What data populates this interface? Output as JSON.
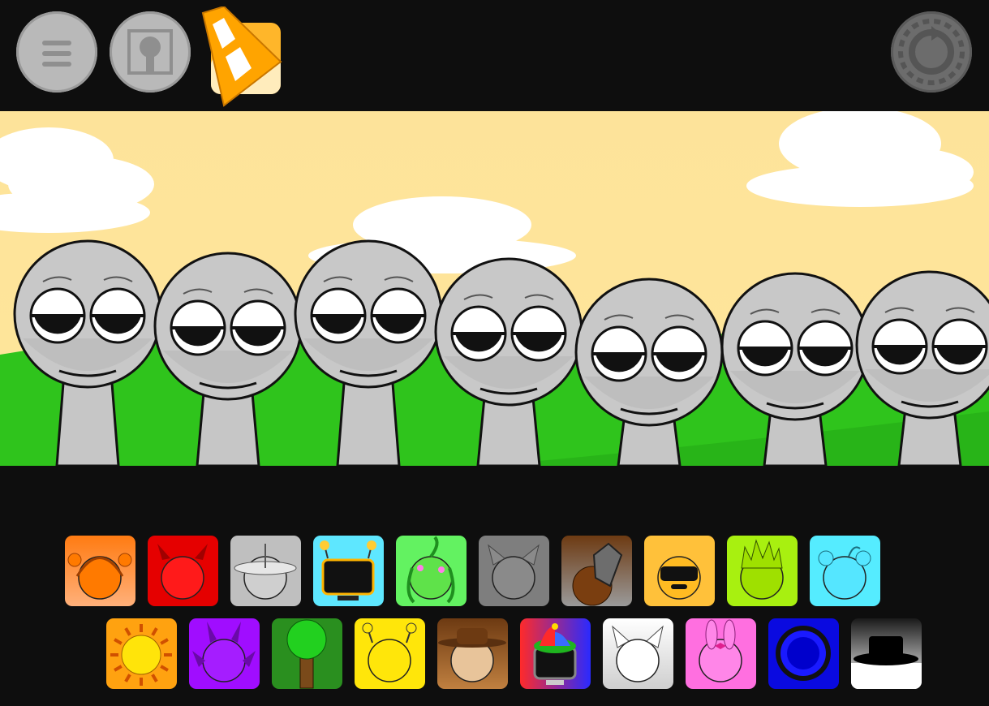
{
  "toolbar": {
    "left_buttons": [
      {
        "id": "menu",
        "icon": "hamburger-icon"
      },
      {
        "id": "cover",
        "icon": "cover-art-icon"
      },
      {
        "id": "vlc",
        "icon": "vlc-cone-icon"
      }
    ],
    "right_buttons": [
      {
        "id": "reset",
        "icon": "reset-icon"
      }
    ]
  },
  "stage": {
    "sky_color": "#fde8a0",
    "grass_color": "#2fc41c",
    "character_count": 7,
    "character_state": "idle-sleepy"
  },
  "palette": {
    "row1": [
      {
        "name": "headphones",
        "bg": "#ff7b12",
        "icon": "headphones-character-icon"
      },
      {
        "name": "horns",
        "bg": "#e50000",
        "icon": "red-horned-character-icon"
      },
      {
        "name": "satellite",
        "bg": "#bfbfbf",
        "icon": "satellite-dish-character-icon"
      },
      {
        "name": "tv",
        "bg": "#5ee7ff",
        "icon": "tv-screen-character-icon"
      },
      {
        "name": "plant",
        "bg": "#63f261",
        "icon": "plant-vine-character-icon"
      },
      {
        "name": "cat",
        "bg": "#7e7e7e",
        "icon": "gray-cat-character-icon"
      },
      {
        "name": "bucket",
        "bg": "#7a4a1a",
        "icon": "bucket-character-icon"
      },
      {
        "name": "visor",
        "bg": "#ffc13a",
        "icon": "visor-helmet-character-icon"
      },
      {
        "name": "flame",
        "bg": "#a8f010",
        "icon": "flame-hair-character-icon"
      },
      {
        "name": "bear",
        "bg": "#55ecff",
        "icon": "bear-ears-character-icon"
      }
    ],
    "row2": [
      {
        "name": "sun",
        "bg": "#ffa210",
        "icon": "sun-character-icon"
      },
      {
        "name": "purple-horns",
        "bg": "#a00dff",
        "icon": "purple-horned-character-icon"
      },
      {
        "name": "tree",
        "bg": "#2a8f1f",
        "icon": "tree-character-icon"
      },
      {
        "name": "antenna",
        "bg": "#ffe60a",
        "icon": "yellow-antenna-character-icon"
      },
      {
        "name": "cowboy",
        "bg": "#9a5c25",
        "icon": "cowboy-hat-character-icon"
      },
      {
        "name": "propeller",
        "bg": "#d6206a",
        "icon": "propeller-cap-tv-character-icon"
      },
      {
        "name": "white-cat",
        "bg": "#f2f2f2",
        "icon": "white-cat-character-icon"
      },
      {
        "name": "bunny",
        "bg": "#ff6fe0",
        "icon": "pink-bunny-character-icon"
      },
      {
        "name": "blue-orb",
        "bg": "#0a0ae0",
        "icon": "blue-orb-character-icon"
      },
      {
        "name": "top-hat",
        "bg": "#1a1a1a",
        "icon": "top-hat-character-icon"
      }
    ]
  }
}
